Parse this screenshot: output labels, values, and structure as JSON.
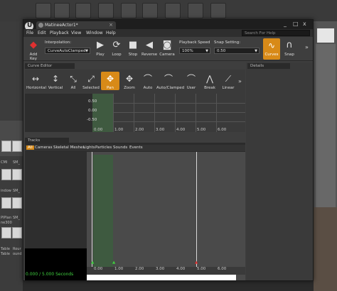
{
  "window": {
    "tab_title": "MatineeActor1*",
    "controls": {
      "minimize": "_",
      "maximize": "□",
      "close": "x"
    }
  },
  "menu": {
    "items": [
      "File",
      "Edit",
      "Playback",
      "View",
      "Window",
      "Help"
    ],
    "search_placeholder": "Search For Help"
  },
  "toolbar": {
    "add_key": "Add Key",
    "interpolation_label": "Interpolation:",
    "interpolation_value": "CurveAutoClamped",
    "play": "Play",
    "loop": "Loop",
    "stop": "Stop",
    "reverse": "Reverse",
    "camera": "Camera",
    "playback_speed_label": "Playback Speed",
    "playback_speed_value": "100%",
    "snap_setting_label": "Snap Setting:",
    "snap_setting_value": "0.50",
    "curves": "Curves",
    "snap": "Snap"
  },
  "curve_editor": {
    "title": "Curve Editor",
    "buttons": [
      "Horizontal",
      "Vertical",
      "All",
      "Selected",
      "Pan",
      "Zoom",
      "Auto",
      "Auto/Clamped",
      "User",
      "Break",
      "Linear"
    ],
    "active_button": "Pan",
    "values": [
      "0.50",
      "0.00",
      "-0.50"
    ],
    "time_ticks": [
      "0.00",
      "1.00",
      "2.00",
      "3.00",
      "4.00",
      "5.00",
      "6.00"
    ]
  },
  "details": {
    "title": "Details"
  },
  "tracks": {
    "title": "Tracks",
    "filters": [
      "All",
      "Cameras",
      "Skeletal Meshes",
      "Lights",
      "Particles",
      "Sounds",
      "Events"
    ],
    "time_readout": "0.000 / 5.000 Seconds",
    "time_ticks": [
      "0.00",
      "1.00",
      "2.00",
      "3.00",
      "4.00",
      "5.00",
      "6.00"
    ]
  },
  "background": {
    "left_labels": [
      "CMI",
      "SM_",
      "indow",
      "SM_",
      "PlPlan",
      "ne300",
      "SM_",
      "Table",
      "Rour",
      "Table",
      "ound"
    ]
  },
  "colors": {
    "accent": "#d88a18",
    "time_green": "#3fcf3f",
    "highlight": "#3f5a40"
  },
  "icons": [
    "unreal-logo-icon",
    "add-key-icon",
    "play-icon",
    "loop-icon",
    "stop-icon",
    "reverse-icon",
    "camera-icon",
    "curves-icon",
    "magnet-icon"
  ]
}
